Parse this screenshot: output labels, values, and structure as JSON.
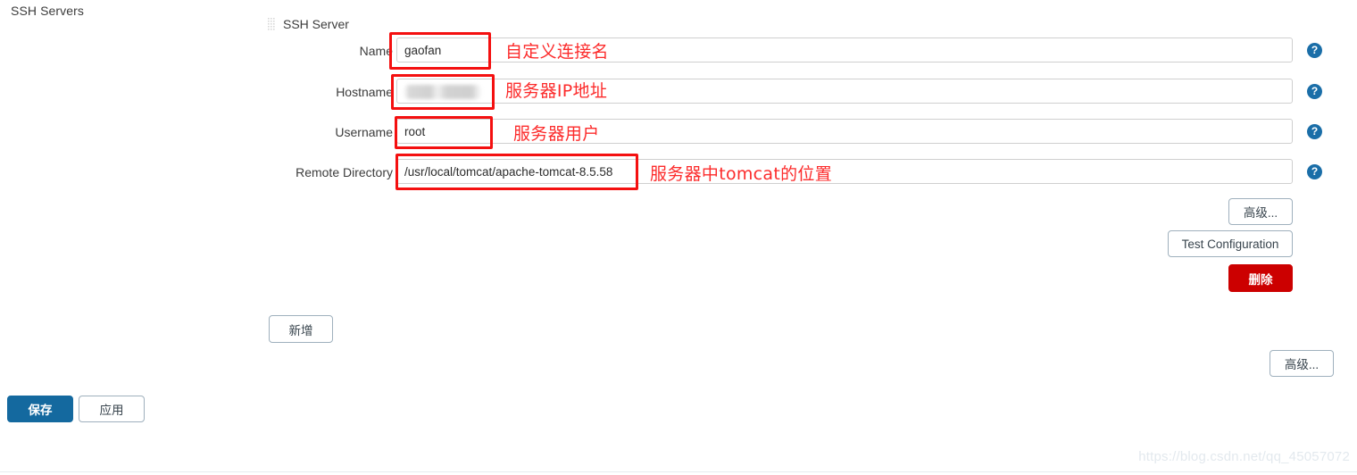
{
  "page": {
    "section_title": "SSH Servers",
    "watermark": "https://blog.csdn.net/qq_45057072"
  },
  "tree": {
    "node_label": "SSH Server",
    "node_icon": "grip-dots-icon"
  },
  "form": {
    "help_icon_glyph": "?",
    "fields": [
      {
        "label": "Name",
        "value": "gaofan",
        "placeholder": "",
        "annotation": "自定义连接名",
        "redacted": false
      },
      {
        "label": "Hostname",
        "value": "",
        "placeholder": "",
        "annotation": "服务器IP地址",
        "redacted": true
      },
      {
        "label": "Username",
        "value": "root",
        "placeholder": "",
        "annotation": "服务器用户",
        "redacted": false
      },
      {
        "label": "Remote Directory",
        "value": "/usr/local/tomcat/apache-tomcat-8.5.58",
        "placeholder": "",
        "annotation": "服务器中tomcat的位置",
        "redacted": false
      }
    ]
  },
  "buttons": {
    "advanced_top": "高级...",
    "test_configuration": "Test Configuration",
    "delete": "删除",
    "add": "新增",
    "advanced_bottom": "高级...",
    "save": "保存",
    "apply": "应用"
  },
  "colors": {
    "annotation_red": "#fc2b2b",
    "highlight_border": "#f41010",
    "primary_blue": "#14699f",
    "danger_red": "#cc0000",
    "help_icon_blue": "#1a6ea8"
  }
}
